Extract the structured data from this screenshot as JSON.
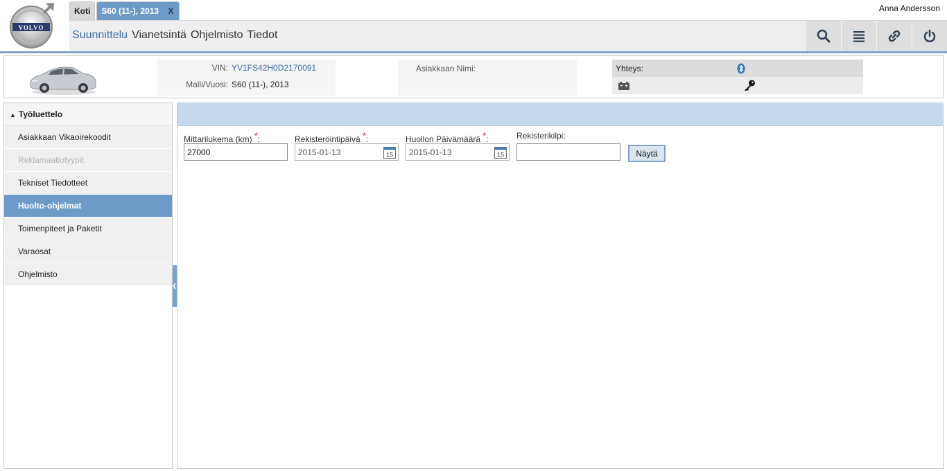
{
  "header": {
    "logo_text": "VOLVO",
    "tabs": [
      {
        "label": "Koti"
      },
      {
        "label": "S60 (11-), 2013",
        "close": "X"
      }
    ],
    "user_name": "Anna Andersson",
    "menu": [
      "Suunnittelu",
      "Vianetsintä",
      "Ohjelmisto",
      "Tiedot"
    ],
    "tools": [
      "search-icon",
      "list-icon",
      "link-icon",
      "power-icon"
    ]
  },
  "vehicle": {
    "vin_label": "VIN:",
    "vin_value": "YV1FS42H0D2170091",
    "model_label": "Malli/Vuosi:",
    "model_value": "S60 (11-), 2013",
    "customer_label": "Asiakkaan Nimi:",
    "connection_label": "Yhteys:"
  },
  "sidebar": {
    "title": "Työluettelo",
    "items": [
      {
        "label": "Asiakkaan Vikaoirekoodit",
        "state": "normal"
      },
      {
        "label": "Reklamaatiotyypit",
        "state": "disabled"
      },
      {
        "label": "Tekniset Tiedotteet",
        "state": "normal"
      },
      {
        "label": "Huolto-ohjelmat",
        "state": "active"
      },
      {
        "label": "Toimenpiteet ja Paketit",
        "state": "normal"
      },
      {
        "label": "Varaosat",
        "state": "normal"
      },
      {
        "label": "Ohjelmisto",
        "state": "normal"
      }
    ]
  },
  "form": {
    "mileage_label": "Mittarilukema (km)",
    "mileage_value": "27000",
    "reg_date_label": "Rekisteröintipäivä",
    "reg_date_value": "2015-01-13",
    "service_date_label": "Huollon Päivämäärä",
    "service_date_value": "2015-01-13",
    "plate_label": "Rekisterikilpi:",
    "plate_value": "",
    "required_marker": "*",
    "colon": ":",
    "calendar_day": "15",
    "show_button": "Näytä"
  },
  "colors": {
    "accent": "#6e9ac8",
    "title_bar": "#c5d9ef",
    "link": "#3b6fa8"
  }
}
